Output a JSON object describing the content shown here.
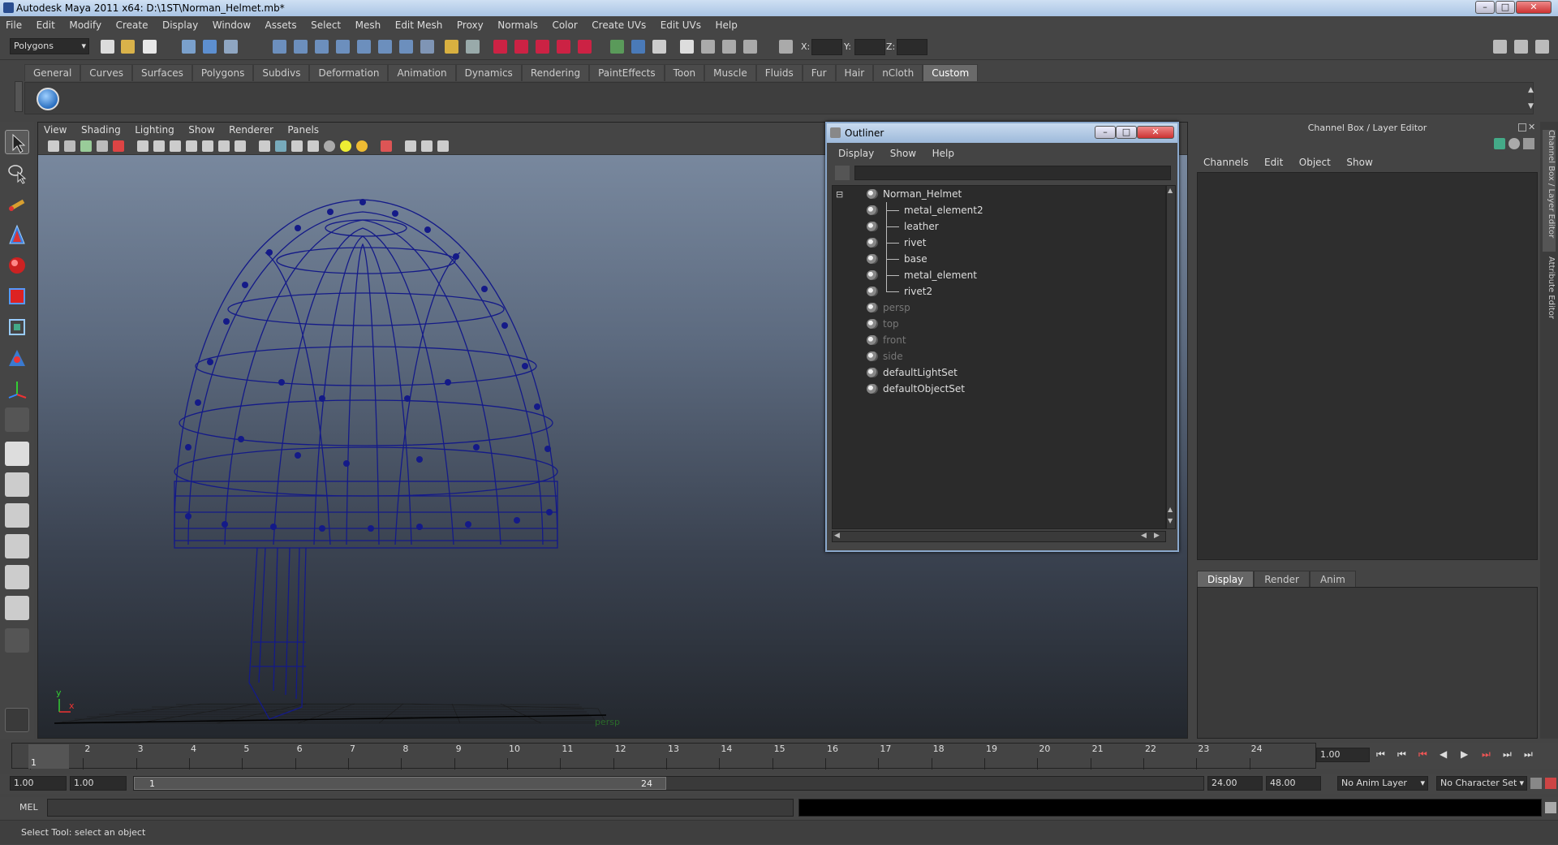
{
  "window": {
    "title": "Autodesk Maya 2011 x64: D:\\1ST\\Norman_Helmet.mb*"
  },
  "menubar": [
    "File",
    "Edit",
    "Modify",
    "Create",
    "Display",
    "Window",
    "Assets",
    "Select",
    "Mesh",
    "Edit Mesh",
    "Proxy",
    "Normals",
    "Color",
    "Create UVs",
    "Edit UVs",
    "Help"
  ],
  "toolbar": {
    "mode": "Polygons",
    "x_label": "X:",
    "y_label": "Y:",
    "z_label": "Z:"
  },
  "shelf_tabs": [
    "General",
    "Curves",
    "Surfaces",
    "Polygons",
    "Subdivs",
    "Deformation",
    "Animation",
    "Dynamics",
    "Rendering",
    "PaintEffects",
    "Toon",
    "Muscle",
    "Fluids",
    "Fur",
    "Hair",
    "nCloth",
    "Custom"
  ],
  "shelf_active": "Custom",
  "viewport": {
    "menu": [
      "View",
      "Shading",
      "Lighting",
      "Show",
      "Renderer",
      "Panels"
    ],
    "camera_label": "persp",
    "axis_y": "y",
    "axis_x": "x"
  },
  "outliner": {
    "title": "Outliner",
    "menu": [
      "Display",
      "Show",
      "Help"
    ],
    "items": [
      {
        "name": "Norman_Helmet",
        "indent": 0,
        "dim": false
      },
      {
        "name": "metal_element2",
        "indent": 1,
        "dim": false
      },
      {
        "name": "leather",
        "indent": 1,
        "dim": false
      },
      {
        "name": "rivet",
        "indent": 1,
        "dim": false
      },
      {
        "name": "base",
        "indent": 1,
        "dim": false
      },
      {
        "name": "metal_element",
        "indent": 1,
        "dim": false
      },
      {
        "name": "rivet2",
        "indent": 1,
        "dim": false
      },
      {
        "name": "persp",
        "indent": 0,
        "dim": true
      },
      {
        "name": "top",
        "indent": 0,
        "dim": true
      },
      {
        "name": "front",
        "indent": 0,
        "dim": true
      },
      {
        "name": "side",
        "indent": 0,
        "dim": true
      },
      {
        "name": "defaultLightSet",
        "indent": 0,
        "dim": false
      },
      {
        "name": "defaultObjectSet",
        "indent": 0,
        "dim": false
      }
    ],
    "expand_symbol": "⊟"
  },
  "channel_box": {
    "title": "Channel Box / Layer Editor",
    "menu": [
      "Channels",
      "Edit",
      "Object",
      "Show"
    ],
    "layer_tabs": [
      "Display",
      "Render",
      "Anim"
    ],
    "layer_active": "Display",
    "side_tabs": [
      "Channel Box / Layer Editor",
      "Attribute Editor"
    ]
  },
  "timeline": {
    "frames": [
      "1",
      "2",
      "3",
      "4",
      "5",
      "6",
      "7",
      "8",
      "9",
      "10",
      "11",
      "12",
      "13",
      "14",
      "15",
      "16",
      "17",
      "18",
      "19",
      "20",
      "21",
      "22",
      "23",
      "24"
    ],
    "current_frame": "1",
    "current_time": "1.00"
  },
  "range": {
    "start": "1.00",
    "start2": "1.00",
    "slider_start": "1",
    "slider_end": "24",
    "end": "24.00",
    "end2": "48.00",
    "anim_layer": "No Anim Layer",
    "char_set": "No Character Set"
  },
  "cmdline": {
    "label": "MEL"
  },
  "status": {
    "message": "Select Tool: select an object"
  },
  "colors": {
    "wireframe": "#141a88",
    "grid": "#1a1a1a",
    "accent": "#8aa8cc"
  }
}
